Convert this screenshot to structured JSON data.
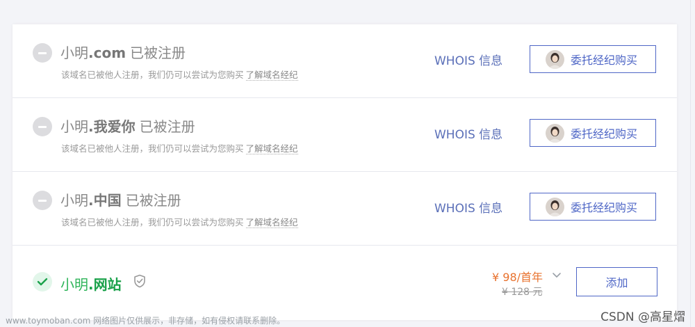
{
  "rows": [
    {
      "name": "小明",
      "suffix": ".com",
      "status": "已被注册",
      "desc": "该域名已被他人注册，我们仍可以尝试为您购买",
      "link": "了解域名经纪",
      "whois": "WHOIS 信息",
      "broker": "委托经纪购买"
    },
    {
      "name": "小明",
      "suffix": ".我爱你",
      "status": "已被注册",
      "desc": "该域名已被他人注册，我们仍可以尝试为您购买",
      "link": "了解域名经纪",
      "whois": "WHOIS 信息",
      "broker": "委托经纪购买"
    },
    {
      "name": "小明",
      "suffix": ".中国",
      "status": "已被注册",
      "desc": "该域名已被他人注册，我们仍可以尝试为您购买",
      "link": "了解域名经纪",
      "whois": "WHOIS 信息",
      "broker": "委托经纪购买"
    }
  ],
  "available": {
    "name": "小明",
    "suffix": ".网站",
    "price": "¥ 98/首年",
    "old_price": "¥ 128 元",
    "add": "添加"
  },
  "watermark_left": "www.toymoban.com 网络图片仅供展示，非存储，如有侵权请联系删除。",
  "watermark_right": "CSDN @高星熠",
  "colors": {
    "accent": "#4e66c6",
    "whois": "#5a6fb8",
    "price": "#e8722e",
    "available": "#1aa14a"
  },
  "icons": [
    "minus-circle-icon",
    "check-circle-icon",
    "shield-check-icon",
    "chevron-down-icon"
  ]
}
